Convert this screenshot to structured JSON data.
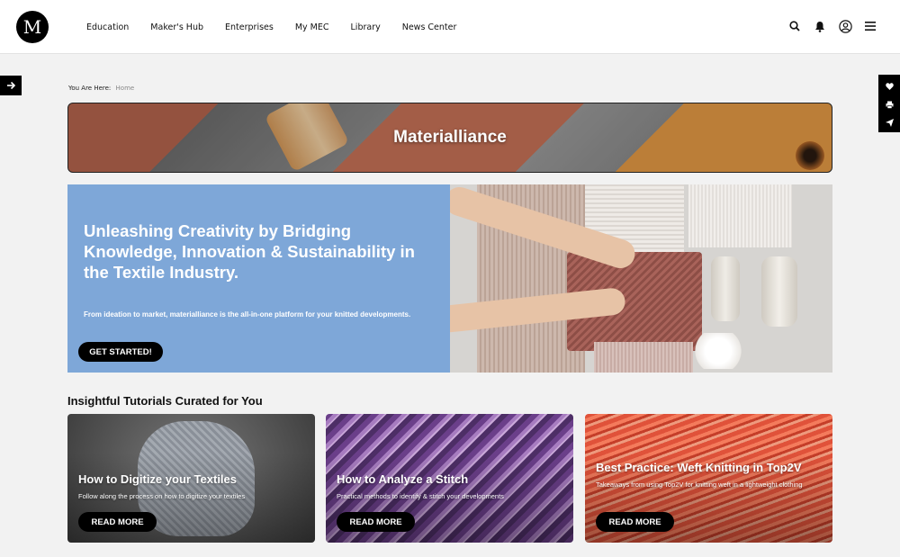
{
  "header": {
    "logo_text": "M",
    "nav": [
      "Education",
      "Maker's Hub",
      "Enterprises",
      "My MEC",
      "Library",
      "News Center"
    ],
    "icons": [
      "search-icon",
      "bell-icon",
      "user-icon",
      "menu-icon"
    ]
  },
  "side": {
    "left_icon": "arrow-right-icon",
    "right_icons": [
      "heart-icon",
      "print-icon",
      "send-icon"
    ]
  },
  "breadcrumb": {
    "label": "You Are Here:",
    "current": "Home"
  },
  "banner": {
    "title": "Materialliance"
  },
  "hero": {
    "title": "Unleashing Creativity by Bridging Knowledge, Innovation & Sustainability in the Textile Industry.",
    "subtitle": "From ideation to market, materialliance is the all-in-one platform for your knitted developments.",
    "cta": "GET STARTED!",
    "bg_color": "#7ea7d8"
  },
  "tutorials": {
    "heading": "Insightful Tutorials Curated for You",
    "cards": [
      {
        "title": "How to Digitize your Textiles",
        "subtitle": "Follow along the process on how to digitize your textiles",
        "button": "READ MORE"
      },
      {
        "title": "How to Analyze a Stitch",
        "subtitle": "Practical methods to identify & stitch your developments",
        "button": "READ MORE"
      },
      {
        "title": "Best Practice: Weft Knitting in Top2V",
        "subtitle": "Takeaways from using Top2V for knitting weft in a lightweight clothing",
        "button": "READ MORE"
      }
    ]
  }
}
